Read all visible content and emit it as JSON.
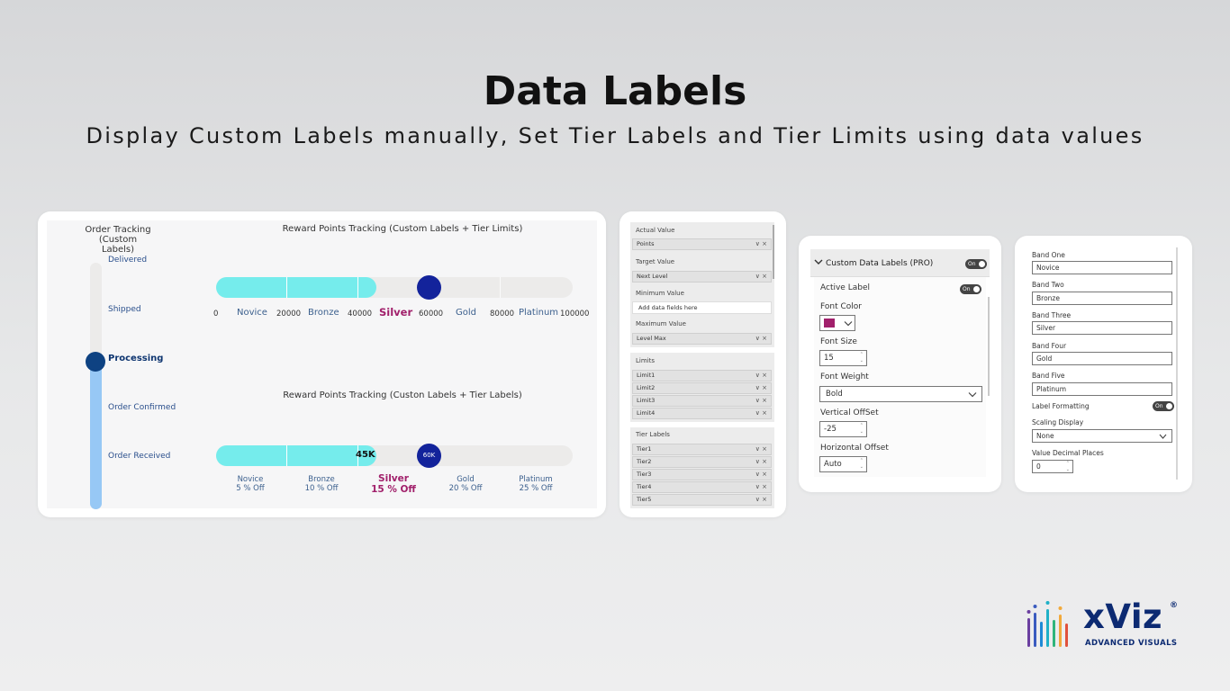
{
  "header": {
    "title": "Data Labels",
    "subtitle": "Display Custom Labels manually, Set Tier Labels and Tier Limits using data values"
  },
  "order_tracking": {
    "title_line1": "Order Tracking (Custom",
    "title_line2": "Labels)",
    "stages": [
      "Delivered",
      "Shipped",
      "Processing",
      "Order Confirmed",
      "Order Received"
    ],
    "current_stage": "Processing",
    "progress_fraction": 0.6
  },
  "reward_limits": {
    "title": "Reward Points Tracking (Custom Labels + Tier Limits)",
    "ticks": [
      "0",
      "20000",
      "40000",
      "60000",
      "80000",
      "100000"
    ],
    "tiers": [
      "Novice",
      "Bronze",
      "Silver",
      "Gold",
      "Platinum"
    ],
    "active_tier": "Silver",
    "actual_value": 45000,
    "target_value": 60000,
    "max_value": 100000
  },
  "reward_tiers": {
    "title": "Reward Points Tracking (Custon Labels + Tier Labels)",
    "actual_label": "45K",
    "target_label": "60K",
    "tiers": [
      {
        "name": "Novice",
        "sub": "5 % Off"
      },
      {
        "name": "Bronze",
        "sub": "10 % Off"
      },
      {
        "name": "Silver",
        "sub": "15 % Off"
      },
      {
        "name": "Gold",
        "sub": "20 % Off"
      },
      {
        "name": "Platinum",
        "sub": "25 % Off"
      }
    ],
    "active_tier": "Silver"
  },
  "field_well": {
    "actual_value_label": "Actual Value",
    "actual_value_field": "Points",
    "target_value_label": "Target Value",
    "target_value_field": "Next Level",
    "minimum_value_label": "Minimum Value",
    "minimum_value_placeholder": "Add data fields here",
    "maximum_value_label": "Maximum Value",
    "maximum_value_field": "Level Max",
    "limits_label": "Limits",
    "limits": [
      "Limit1",
      "Limit2",
      "Limit3",
      "Limit4"
    ],
    "tier_labels_label": "Tier Labels",
    "tier_labels": [
      "Tier1",
      "Tier2",
      "Tier3",
      "Tier4",
      "Tier5"
    ],
    "controls": "∨ ×"
  },
  "format_pane": {
    "section_title": "Custom Data Labels (PRO)",
    "section_toggle": "On",
    "active_label": "Active Label",
    "active_toggle": "On",
    "font_color_label": "Font Color",
    "font_color": "#a1206b",
    "font_size_label": "Font Size",
    "font_size": "15",
    "font_weight_label": "Font Weight",
    "font_weight": "Bold",
    "vertical_offset_label": "Vertical OffSet",
    "vertical_offset": "-25",
    "horizontal_offset_label": "Horizontal Offset",
    "horizontal_offset": "Auto"
  },
  "bands": {
    "items": [
      {
        "label": "Band One",
        "value": "Novice"
      },
      {
        "label": "Band Two",
        "value": "Bronze"
      },
      {
        "label": "Band Three",
        "value": "Silver"
      },
      {
        "label": "Band Four",
        "value": "Gold"
      },
      {
        "label": "Band Five",
        "value": "Platinum"
      }
    ],
    "label_formatting": "Label Formatting",
    "label_formatting_toggle": "On",
    "scaling_display_label": "Scaling Display",
    "scaling_display": "None",
    "decimal_places_label": "Value Decimal Places",
    "decimal_places": "0"
  },
  "logo": {
    "brand": "xViz",
    "registered": "®",
    "tagline": "ADVANCED   VISUALS"
  },
  "colors": {
    "fill_cyan": "#75ecec",
    "knob_navy": "#13239b",
    "vertical_fill": "#97c8f5",
    "vertical_knob": "#0e4282",
    "highlight": "#a1206b"
  }
}
